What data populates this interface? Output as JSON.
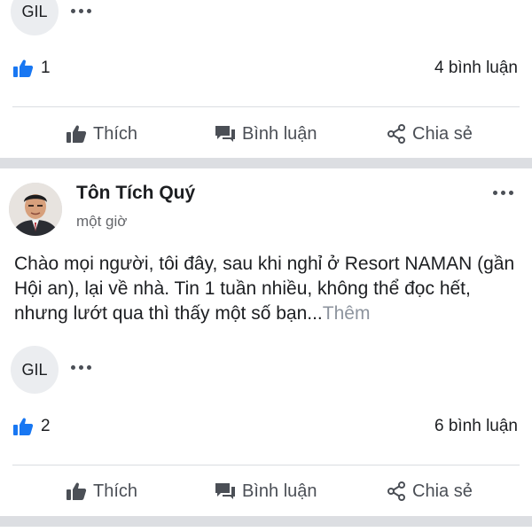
{
  "top_post": {
    "commenter_initials": "GIL",
    "like_count": "1",
    "comment_count": "4 bình luận",
    "actions": {
      "like": "Thích",
      "comment": "Bình luận",
      "share": "Chia sẻ"
    }
  },
  "post": {
    "author": "Tôn Tích Quý",
    "time": "một giờ",
    "text": "Chào mọi người, tôi đây, sau khi nghỉ ở Resort NAMAN (gần Hội an), lại về nhà. Tin 1 tuần nhiều, không thể đọc hết, nhưng lướt qua thì thấy một số bạn...",
    "see_more": "Thêm",
    "commenter_initials": "GIL",
    "like_count": "2",
    "comment_count": "6 bình luận",
    "actions": {
      "like": "Thích",
      "comment": "Bình luận",
      "share": "Chia sẻ"
    }
  },
  "colors": {
    "like_blue": "#1877f2",
    "divider": "#dadde1",
    "band": "#dcdee2"
  },
  "icons": {
    "thumbs_up": "thumbs-up-icon",
    "comment": "comment-icon",
    "share": "share-icon",
    "more": "more-dots-icon"
  }
}
